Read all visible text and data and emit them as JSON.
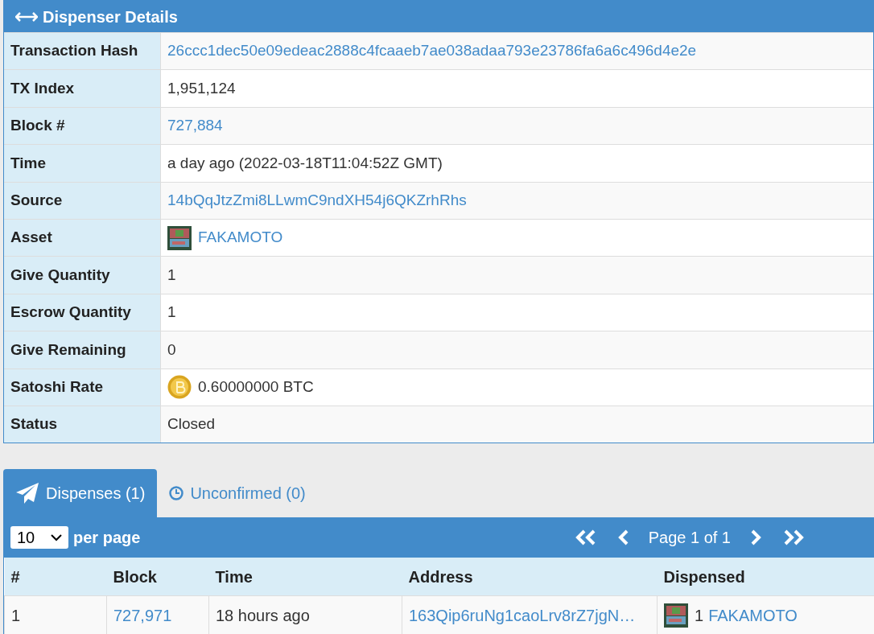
{
  "panel": {
    "title": "Dispenser Details"
  },
  "details": [
    {
      "label": "Transaction Hash",
      "value": "26ccc1dec50e09edeac2888c4fcaaeb7ae038adaa793e23786fa6a6c496d4e2e",
      "kind": "link"
    },
    {
      "label": "TX Index",
      "value": "1,951,124",
      "kind": "text"
    },
    {
      "label": "Block #",
      "value": "727,884",
      "kind": "link"
    },
    {
      "label": "Time",
      "value": "a day ago (2022-03-18T11:04:52Z GMT)",
      "kind": "text"
    },
    {
      "label": "Source",
      "value": "14bQqJtzZmi8LLwmC9ndXH54j6QKZrhRhs",
      "kind": "link"
    },
    {
      "label": "Asset",
      "value": "FAKAMOTO",
      "kind": "asset"
    },
    {
      "label": "Give Quantity",
      "value": "1",
      "kind": "text"
    },
    {
      "label": "Escrow Quantity",
      "value": "1",
      "kind": "text"
    },
    {
      "label": "Give Remaining",
      "value": "0",
      "kind": "text"
    },
    {
      "label": "Satoshi Rate",
      "value": "0.60000000 BTC",
      "kind": "btc"
    },
    {
      "label": "Status",
      "value": "Closed",
      "kind": "text"
    }
  ],
  "tabs": [
    {
      "label": "Dispenses (1)",
      "selected": true,
      "kind": "plane"
    },
    {
      "label": "Unconfirmed (0)",
      "selected": false,
      "kind": "clock"
    }
  ],
  "toolbar": {
    "per_page_value": "10",
    "per_page_label": "per page",
    "page_text": "Page 1 of 1"
  },
  "table": {
    "columns": [
      "#",
      "Block",
      "Time",
      "Address",
      "Dispensed"
    ],
    "rows": [
      {
        "index": "1",
        "block": "727,971",
        "time": "18 hours ago",
        "address": "163Qip6ruNg1caoLrv8rZ7jgN…",
        "quantity": "1",
        "asset": "FAKAMOTO"
      }
    ]
  }
}
